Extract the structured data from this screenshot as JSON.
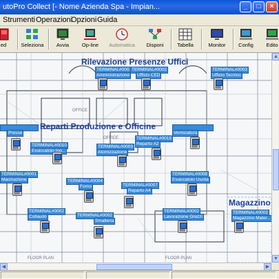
{
  "window": {
    "title": "utoPro Collect [- Nome Azienda Spa - Impian..."
  },
  "menu": {
    "items": [
      "Strumenti",
      "Operazioni",
      "Opzioni",
      "Guida"
    ]
  },
  "toolbar": {
    "items": [
      {
        "label": "ed",
        "icon": "exit-icon"
      },
      {
        "label": "Seleziona",
        "icon": "select-icon"
      },
      {
        "label": "Avvia",
        "icon": "start-icon"
      },
      {
        "label": "Op-line",
        "icon": "online-icon"
      },
      {
        "label": "Automatica",
        "icon": "clock-icon",
        "disabled": true
      },
      {
        "label": "Disponi",
        "icon": "arrange-icon"
      },
      {
        "label": "Tabella",
        "icon": "table-icon"
      },
      {
        "label": "Monitor",
        "icon": "monitor-icon"
      },
      {
        "label": "Config",
        "icon": "config-icon"
      },
      {
        "label": "Edito",
        "icon": "editor-icon"
      }
    ]
  },
  "zones": {
    "uffici": "Rilevazione Presenze Uffici",
    "produzione": "Reparti Produzione e Officine",
    "magazzino": "Magazzino"
  },
  "terminals": [
    {
      "label": "TERMINAL#0001",
      "sub": "Amministrazione"
    },
    {
      "label": "TERMINAL#0002",
      "sub": "Ufficio CED"
    },
    {
      "label": "TERMINAL#0003",
      "sub": "Ufficio Tecnico"
    },
    {
      "label": "",
      "sub": "Presse"
    },
    {
      "label": "",
      "sub": "Verniciatura"
    },
    {
      "label": "TERMINAL#0010",
      "sub": "Essiccatoio Ing..."
    },
    {
      "label": "TERMINAL#0003",
      "sub": "Atomizzazione"
    },
    {
      "label": "TERMINAL#0015",
      "sub": "Reparto A2"
    },
    {
      "label": "TERMINAL#0001",
      "sub": "Macinazione"
    },
    {
      "label": "TERMINAL#0004",
      "sub": "Forno"
    },
    {
      "label": "TERMINAL#0007",
      "sub": "Reparto A4"
    },
    {
      "label": "TERMINAL#0008",
      "sub": "Essiccatoio Uscita"
    },
    {
      "label": "TERMINAL#0002",
      "sub": "Collaudo"
    },
    {
      "label": "TERMINAL#0002",
      "sub": "Smalteria"
    },
    {
      "label": "TERMINAL#0002",
      "sub": "Lavorazione Grezzi"
    },
    {
      "label": "TERMINAL#0002",
      "sub": "Magazzino Mater..."
    }
  ]
}
